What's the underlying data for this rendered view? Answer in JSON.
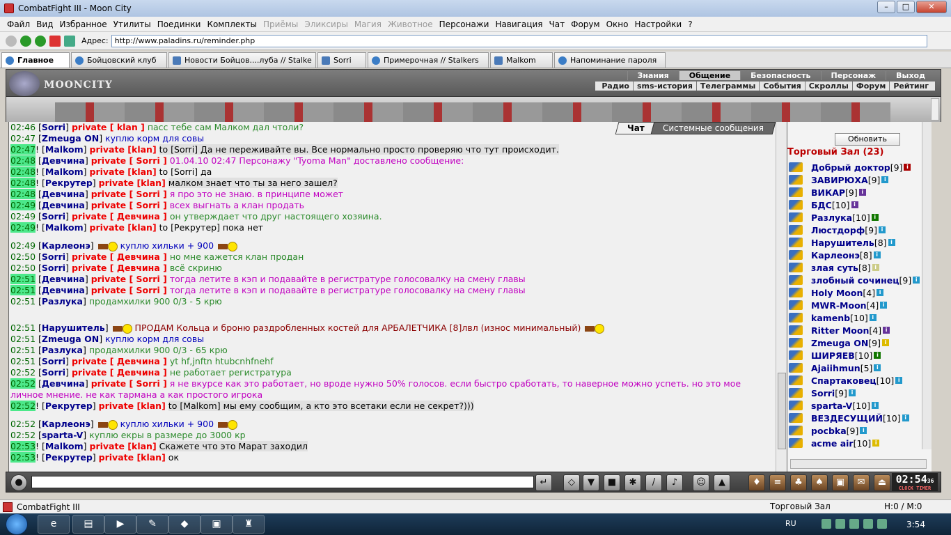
{
  "window": {
    "title": "CombatFight III - Moon City"
  },
  "menu": [
    "Файл",
    "Вид",
    "Избранное",
    "Утилиты",
    "Поединки",
    "Комплекты",
    "Приёмы",
    "Эликсиры",
    "Магия",
    "Животное",
    "Персонажи",
    "Навигация",
    "Чат",
    "Форум",
    "Окно",
    "Настройки",
    "?"
  ],
  "menu_disabled": [
    "Приёмы",
    "Эликсиры",
    "Магия",
    "Животное"
  ],
  "address": {
    "label": "Адрес:",
    "value": "http://www.paladins.ru/reminder.php"
  },
  "tabs": [
    {
      "label": "Главное",
      "w": 98
    },
    {
      "label": "Бойцовский клуб",
      "w": 138
    },
    {
      "label": "Новости Бойцов....луба // Stalke",
      "w": 212
    },
    {
      "label": "Sorri",
      "w": 70
    },
    {
      "label": "Примерочная // Stalkers",
      "w": 174
    },
    {
      "label": "Malkom",
      "w": 90
    },
    {
      "label": "Напоминание пароля",
      "w": 160
    }
  ],
  "game": {
    "logo_text": "MOONCITY",
    "topnav": [
      "Знания",
      "Общение",
      "Безопасность",
      "Персонаж",
      "Выход"
    ],
    "topnav_selected": "Общение",
    "subnav": [
      "Радио",
      "sms-история",
      "Телеграммы",
      "События",
      "Скроллы",
      "Форум",
      "Рейтинг"
    ]
  },
  "chat": {
    "tabs": [
      "Чат",
      "Системные сообщения"
    ],
    "messages": [
      {
        "time": "02:46",
        "hl": false,
        "excl": false,
        "user": "Sorri",
        "priv": "private [ klan ]",
        "text": "пасс тебе сам Малком дал чтоли?",
        "color": "gr"
      },
      {
        "time": "02:47",
        "hl": false,
        "excl": false,
        "user": "Zmeuga ON",
        "priv": "",
        "text": "куплю корм для совы",
        "color": "bl"
      },
      {
        "time": "02:47",
        "hl": true,
        "excl": true,
        "user": "Malkom",
        "priv": "private [klan]",
        "text": "to [Sorri] Да не переживайте вы. Все нормально просто проверяю что тут происходит.",
        "color": "bk",
        "bg": true
      },
      {
        "time": "02:48",
        "hl": true,
        "excl": false,
        "user": "Девчина",
        "priv": "private [ Sorri ]",
        "text": "01.04.10 02:47 Персонажу \"Tyoma Man\" доставлено сообщение:",
        "color": "mg"
      },
      {
        "time": "02:48",
        "hl": true,
        "excl": true,
        "user": "Malkom",
        "priv": "private [klan]",
        "text": "to [Sorri] да",
        "color": "bk"
      },
      {
        "time": "02:48",
        "hl": true,
        "excl": true,
        "user": "Рекрутер",
        "priv": "private [klan]",
        "text": "малком знает что ты за него зашел?",
        "color": "bk",
        "bg": true
      },
      {
        "time": "02:48",
        "hl": true,
        "excl": false,
        "user": "Девчина",
        "priv": "private [ Sorri ]",
        "text": "я про это не знаю. в принципе может",
        "color": "mg"
      },
      {
        "time": "02:49",
        "hl": true,
        "excl": false,
        "user": "Девчина",
        "priv": "private [ Sorri ]",
        "text": "всех выгнать а клан продать",
        "color": "mg"
      },
      {
        "time": "02:49",
        "hl": false,
        "excl": false,
        "user": "Sorri",
        "priv": "private [ Девчина ]",
        "text": "он утверждает что друг настоящего хозяина.",
        "color": "gr"
      },
      {
        "time": "02:49",
        "hl": true,
        "excl": true,
        "user": "Malkom",
        "priv": "private [klan]",
        "text": "to [Рекрутер] пока нет",
        "color": "bk"
      },
      {
        "gap": true
      },
      {
        "time": "02:49",
        "hl": false,
        "excl": false,
        "user": "Карлеонэ",
        "priv": "",
        "text": "куплю хильки + 900",
        "color": "bl",
        "icons": true
      },
      {
        "time": "02:50",
        "hl": false,
        "excl": false,
        "user": "Sorri",
        "priv": "private [ Девчина ]",
        "text": "но мне кажется клан продан",
        "color": "gr"
      },
      {
        "time": "02:50",
        "hl": false,
        "excl": false,
        "user": "Sorri",
        "priv": "private [ Девчина ]",
        "text": "всё скриню",
        "color": "gr"
      },
      {
        "time": "02:51",
        "hl": true,
        "excl": false,
        "user": "Девчина",
        "priv": "private [ Sorri ]",
        "text": "тогда летите в кэп и подавайте в регистратуре голосовалку на смену главы",
        "color": "mg"
      },
      {
        "time": "02:51",
        "hl": true,
        "excl": false,
        "user": "Девчина",
        "priv": "private [ Sorri ]",
        "text": "тогда летите в кэп и подавайте в регистратуре голосовалку на смену главы",
        "color": "mg"
      },
      {
        "time": "02:51",
        "hl": false,
        "excl": false,
        "user": "Разлука",
        "priv": "",
        "text": "продамхилки 900 0/3 - 5 крю",
        "color": "gr"
      },
      {
        "gap2": true
      },
      {
        "time": "02:51",
        "hl": false,
        "excl": false,
        "user": "Нарушитель",
        "priv": "",
        "text": "ПРОДАМ Кольца и броню раздробленных костей для АРБАЛЕТЧИКА       [8]лвл (износ минимальный)",
        "color": "br",
        "icons": true
      },
      {
        "time": "02:51",
        "hl": false,
        "excl": false,
        "user": "Zmeuga ON",
        "priv": "",
        "text": "куплю корм для совы",
        "color": "bl"
      },
      {
        "time": "02:51",
        "hl": false,
        "excl": false,
        "user": "Разлука",
        "priv": "",
        "text": "продамхилки 900 0/3 - 65 крю",
        "color": "gr"
      },
      {
        "time": "02:51",
        "hl": false,
        "excl": false,
        "user": "Sorri",
        "priv": "private [ Девчина ]",
        "text": "yt hf,jnftn htubcnhfnehf",
        "color": "gr"
      },
      {
        "time": "02:52",
        "hl": false,
        "excl": false,
        "user": "Sorri",
        "priv": "private [ Девчина ]",
        "text": "не работает регистратура",
        "color": "gr"
      },
      {
        "time": "02:52",
        "hl": true,
        "excl": false,
        "user": "Девчина",
        "priv": "private [ Sorri ]",
        "text": "я не вкурсе как это работает, но вроде нужно 50% голосов. если быстро сработать, то наверное можно успеть. но это мое личное мнение. не как тармана а как простого игрока",
        "color": "mg",
        "wrap": true
      },
      {
        "time": "02:52",
        "hl": true,
        "excl": true,
        "user": "Рекрутер",
        "priv": "private [klan]",
        "text": "to [Malkom] мы ему сообщим, а кто это всетаки если не секрет?)))",
        "color": "bk",
        "bg": true
      },
      {
        "gap": true
      },
      {
        "time": "02:52",
        "hl": false,
        "excl": false,
        "user": "Карлеонэ",
        "priv": "",
        "text": "куплю хильки + 900",
        "color": "bl",
        "icons": true
      },
      {
        "time": "02:52",
        "hl": false,
        "excl": false,
        "user": "sparta-V",
        "priv": "",
        "text": "куплю екры в размере до 3000 кр",
        "color": "gr"
      },
      {
        "time": "02:53",
        "hl": true,
        "excl": true,
        "user": "Malkom",
        "priv": "private [klan]",
        "text": "Скажете что это Марат заходил",
        "color": "bk",
        "bg": true
      },
      {
        "time": "02:53",
        "hl": true,
        "excl": true,
        "user": "Рекрутер",
        "priv": "private [klan]",
        "text": "ок",
        "color": "bk"
      }
    ]
  },
  "sidebar": {
    "refresh_label": "Обновить",
    "hall_title": "Торговый Зал (23)",
    "players": [
      {
        "name": "Добрый доктор",
        "level": "[9]",
        "info": "#a00"
      },
      {
        "name": "ЗАВИРЮХА",
        "level": "[9]",
        "info": "#29c"
      },
      {
        "name": "ВИКАР",
        "level": "[9]",
        "info": "#639"
      },
      {
        "name": "БДС",
        "level": "[10]",
        "info": "#639"
      },
      {
        "name": "Разлука",
        "level": "[10]",
        "info": "#170"
      },
      {
        "name": "Люстдорф",
        "level": "[9]",
        "info": "#29c"
      },
      {
        "name": "Нарушитель",
        "level": "[8]",
        "info": "#29c"
      },
      {
        "name": "Карлеонэ",
        "level": "[8]",
        "info": "#29c"
      },
      {
        "name": "злая суть",
        "level": "[8]",
        "info": "#cc8"
      },
      {
        "name": "злобный сочинец",
        "level": "[9]",
        "info": "#29c"
      },
      {
        "name": "Holy Moon",
        "level": "[4]",
        "info": "#29c"
      },
      {
        "name": "MWR-Moon",
        "level": "[4]",
        "info": "#29c"
      },
      {
        "name": "kamenb",
        "level": "[10]",
        "info": "#29c"
      },
      {
        "name": "Ritter Moon",
        "level": "[4]",
        "info": "#639"
      },
      {
        "name": "Zmeuga ON",
        "level": "[9]",
        "info": "#db0"
      },
      {
        "name": "ШИРЯЕВ",
        "level": "[10]",
        "info": "#170"
      },
      {
        "name": "Ajaiihmun",
        "level": "[5]",
        "info": "#29c"
      },
      {
        "name": "Спартаковец",
        "level": "[10]",
        "info": "#29c"
      },
      {
        "name": "Sorri",
        "level": "[9]",
        "info": "#29c"
      },
      {
        "name": "sparta-V",
        "level": "[10]",
        "info": "#29c"
      },
      {
        "name": "ВЕЗДЕСУЩИЙ",
        "level": "[10]",
        "info": "#29c"
      },
      {
        "name": "pocbka",
        "level": "[9]",
        "info": "#29c"
      },
      {
        "name": "acme air",
        "level": "[10]",
        "info": "#db0"
      }
    ]
  },
  "toolbar": {
    "clock": "02:54",
    "seconds": "36",
    "clock_label": "CLOCK TIMER"
  },
  "status": {
    "app": "CombatFight III",
    "zone": "Торговый Зал",
    "hm": "H:0 / M:0"
  },
  "taskbar": {
    "lang": "RU",
    "time": "3:54"
  }
}
